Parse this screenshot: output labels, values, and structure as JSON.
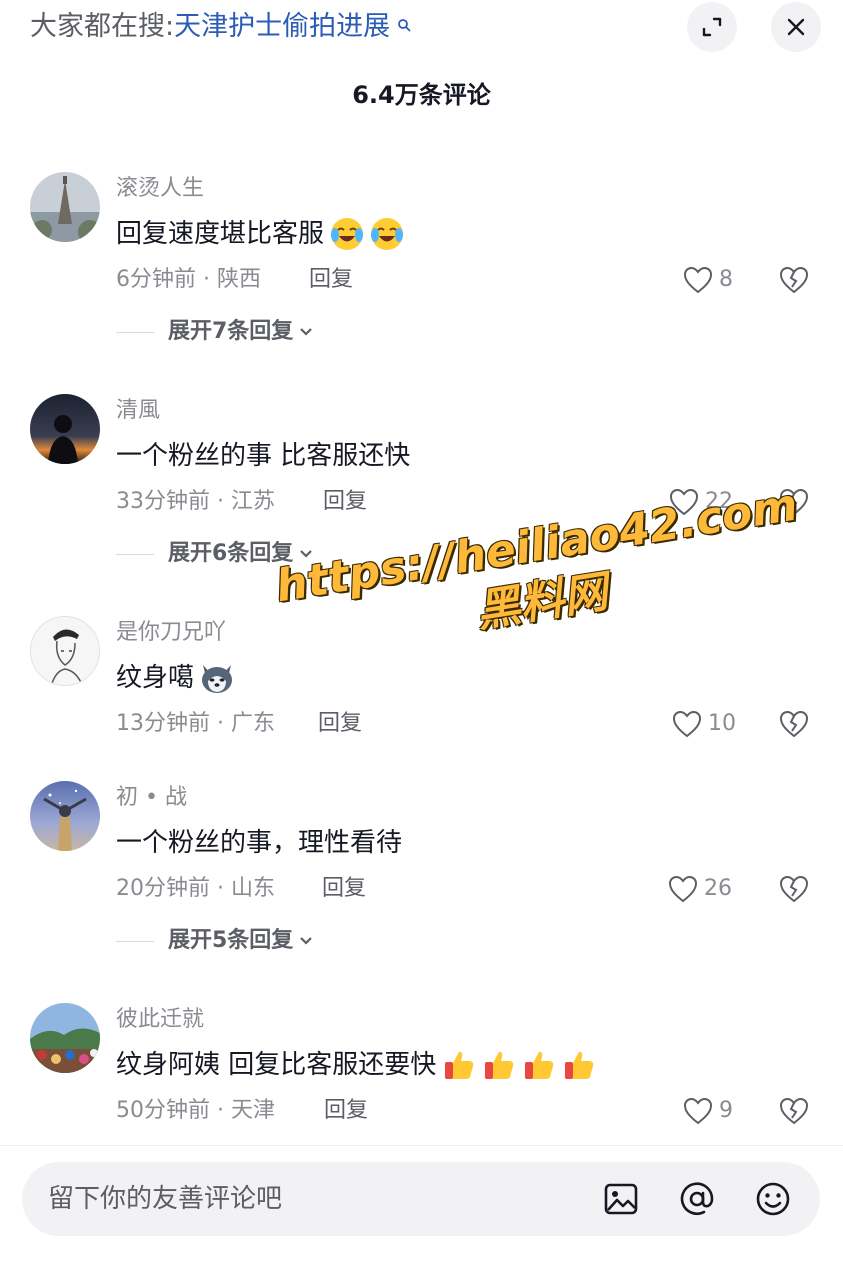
{
  "search_bar": {
    "prefix": "大家都在搜:",
    "query": "天津护士偷拍进展"
  },
  "header": {
    "comment_count": "6.4万条评论"
  },
  "comments": [
    {
      "username": "滚烫人生",
      "text": "回复速度堪比客服",
      "emojis": [
        "crying-laughing-emoji",
        "crying-laughing-emoji"
      ],
      "time": "6分钟前",
      "location": "陕西",
      "reply_label": "回复",
      "likes": "8",
      "expand_label": "展开7条回复"
    },
    {
      "username": "清風",
      "text": "一个粉丝的事 比客服还快",
      "emojis": [],
      "time": "33分钟前",
      "location": "江苏",
      "reply_label": "回复",
      "likes": "22",
      "expand_label": "展开6条回复"
    },
    {
      "username": "是你刀兄吖",
      "text": "纹身噶",
      "emojis": [
        "husky-emoji"
      ],
      "time": "13分钟前",
      "location": "广东",
      "reply_label": "回复",
      "likes": "10",
      "expand_label": ""
    },
    {
      "username": "初 • 战",
      "text": "一个粉丝的事，理性看待",
      "emojis": [],
      "time": "20分钟前",
      "location": "山东",
      "reply_label": "回复",
      "likes": "26",
      "expand_label": "展开5条回复"
    },
    {
      "username": "彼此迁就",
      "text": "纹身阿姨 回复比客服还要快",
      "emojis": [
        "thumbs-up-emoji",
        "thumbs-up-emoji",
        "thumbs-up-emoji",
        "thumbs-up-emoji"
      ],
      "time": "50分钟前",
      "location": "天津",
      "reply_label": "回复",
      "likes": "9",
      "expand_label": ""
    }
  ],
  "watermark": {
    "url": "https://heiliao42.com",
    "name": "黑料网"
  },
  "input": {
    "placeholder": "留下你的友善评论吧"
  },
  "colors": {
    "link_blue": "#2b5cb6",
    "muted_gray": "#8a8b91",
    "text_dark": "#161823",
    "watermark_orange": "#ffb93a"
  }
}
